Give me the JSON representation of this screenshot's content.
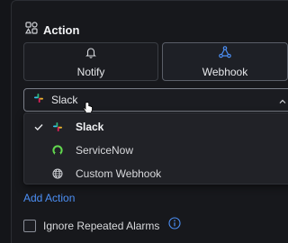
{
  "header": {
    "title": "Action",
    "icon": "shapes-icon"
  },
  "tabs": [
    {
      "label": "Notify",
      "icon": "bell-icon",
      "selected": false
    },
    {
      "label": "Webhook",
      "icon": "webhook-icon",
      "selected": true
    }
  ],
  "select": {
    "value": "Slack",
    "icon": "slack-icon"
  },
  "dropdown": {
    "options": [
      {
        "label": "Slack",
        "icon": "slack-icon",
        "checked": true
      },
      {
        "label": "ServiceNow",
        "icon": "servicenow-icon",
        "checked": false
      },
      {
        "label": "Custom Webhook",
        "icon": "globe-icon",
        "checked": false
      }
    ]
  },
  "add_action_label": "Add Action",
  "ignore_alarms": {
    "label": "Ignore Repeated Alarms",
    "checked": false,
    "icon": "info-icon"
  },
  "colors": {
    "accent": "#4c8ff5",
    "background": "#141519",
    "menu": "#212227"
  }
}
